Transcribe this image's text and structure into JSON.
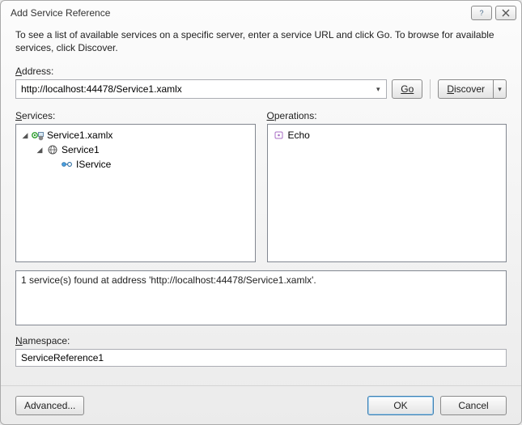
{
  "dialog": {
    "title": "Add Service Reference",
    "instructions": "To see a list of available services on a specific server, enter a service URL and click Go. To browse for available services, click Discover."
  },
  "labels": {
    "address": "Address:",
    "services": "Services:",
    "operations": "Operations:",
    "namespace": "Namespace:"
  },
  "address": {
    "value": "http://localhost:44478/Service1.xamlx"
  },
  "buttons": {
    "go": "Go",
    "discover": "Discover",
    "advanced": "Advanced...",
    "ok": "OK",
    "cancel": "Cancel"
  },
  "services_tree": {
    "root": "Service1.xamlx",
    "child": "Service1",
    "leaf": "IService"
  },
  "operations": {
    "item1": "Echo"
  },
  "status": {
    "text": "1 service(s) found at address 'http://localhost:44478/Service1.xamlx'."
  },
  "namespace": {
    "value": "ServiceReference1"
  }
}
